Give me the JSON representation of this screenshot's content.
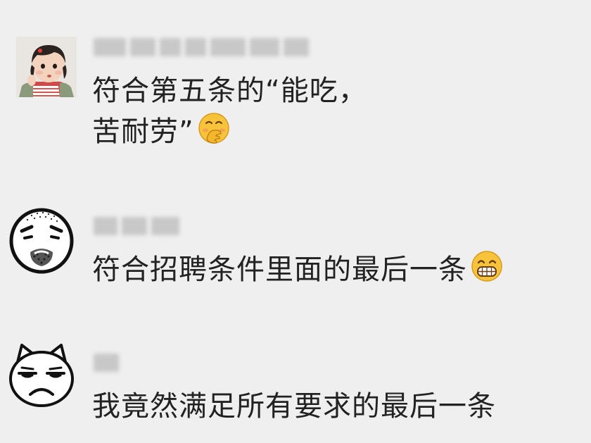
{
  "comments": [
    {
      "text_lines": [
        "符合第五条的“能吃，",
        "苦耐劳”"
      ],
      "avatar_icon": "toddler-photo-avatar",
      "emoji_icon": "face-with-hand-over-mouth-emoji",
      "name_blurred": true
    },
    {
      "text_lines": [
        "符合招聘条件里面的最后一条"
      ],
      "avatar_icon": "sad-bearded-doodle-avatar",
      "emoji_icon": "grinning-teeth-emoji",
      "name_blurred": true
    },
    {
      "text_lines": [
        "我竟然满足所有要求的最后一条"
      ],
      "avatar_icon": "grumpy-cat-doodle-avatar",
      "name_blurred": true
    }
  ],
  "colors": {
    "background": "#efefef",
    "text": "#222222",
    "blurred_name": "#c8c8c8"
  }
}
